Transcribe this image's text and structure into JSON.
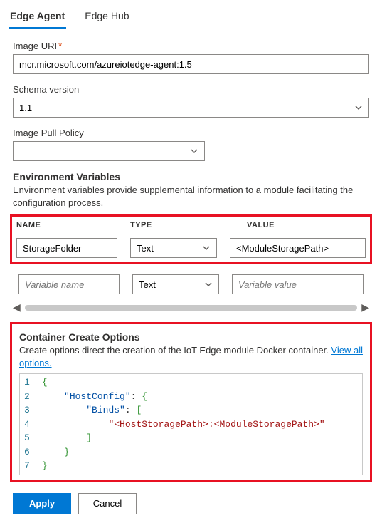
{
  "tabs": {
    "edge_agent": "Edge Agent",
    "edge_hub": "Edge Hub"
  },
  "image_uri": {
    "label": "Image URI",
    "required_mark": "*",
    "value": "mcr.microsoft.com/azureiotedge-agent:1.5"
  },
  "schema_version": {
    "label": "Schema version",
    "value": "1.1"
  },
  "image_pull_policy": {
    "label": "Image Pull Policy",
    "value": ""
  },
  "env": {
    "title": "Environment Variables",
    "desc": "Environment variables provide supplemental information to a module facilitating the configuration process.",
    "header_name": "NAME",
    "header_type": "TYPE",
    "header_value": "VALUE",
    "row1": {
      "name": "StorageFolder",
      "type": "Text",
      "value": "<ModuleStoragePath>"
    },
    "row2": {
      "name_placeholder": "Variable name",
      "type": "Text",
      "value_placeholder": "Variable value"
    }
  },
  "cco": {
    "title": "Container Create Options",
    "desc_text": "Create options direct the creation of the IoT Edge module Docker container. ",
    "desc_link": "View all options.",
    "code": "{\n    \"HostConfig\": {\n        \"Binds\": [\n            \"<HostStoragePath>:<ModuleStoragePath>\"\n        ]\n    }\n}",
    "lines": [
      "1",
      "2",
      "3",
      "4",
      "5",
      "6",
      "7"
    ]
  },
  "buttons": {
    "apply": "Apply",
    "cancel": "Cancel"
  }
}
